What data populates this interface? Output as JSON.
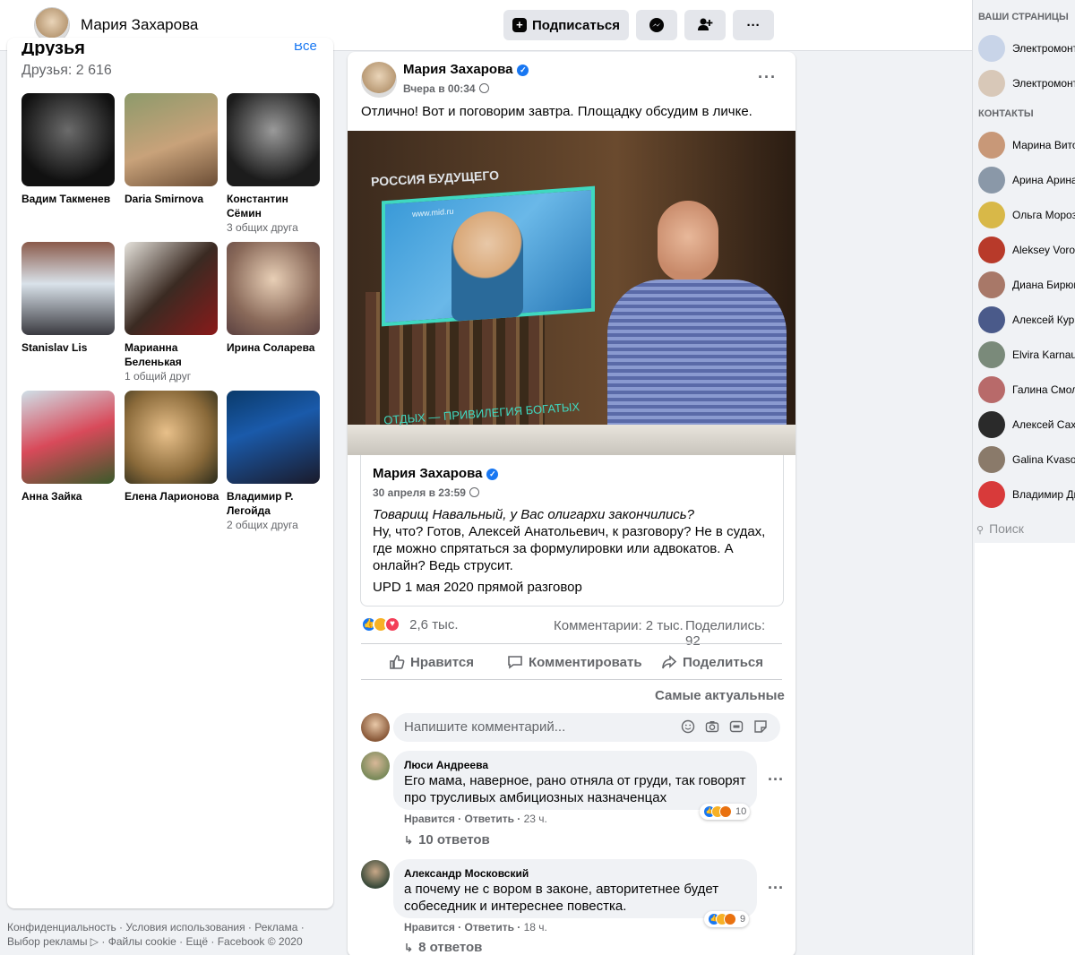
{
  "header": {
    "name": "Мария Захарова",
    "subscribe_label": "Подписаться",
    "messenger_icon": "messenger-icon",
    "add_friend_icon": "add-friend-icon",
    "more_label": "···"
  },
  "friends": {
    "title": "Друзья",
    "all_label": "Все",
    "count_label": "Друзья: 2 616",
    "items": [
      {
        "name": "Вадим Такменев",
        "mutual": ""
      },
      {
        "name": "Daria Smirnova",
        "mutual": ""
      },
      {
        "name": "Константин Сёмин",
        "mutual": "3 общих друга"
      },
      {
        "name": "Stanislav Lis",
        "mutual": ""
      },
      {
        "name": "Марианна Беленькая",
        "mutual": "1 общий друг"
      },
      {
        "name": "Ирина Соларева",
        "mutual": ""
      },
      {
        "name": "Анна Зайка",
        "mutual": ""
      },
      {
        "name": "Елена Ларионова",
        "mutual": ""
      },
      {
        "name": "Владимир Р. Легойда",
        "mutual": "2 общих друга"
      }
    ]
  },
  "footer": {
    "line1": "Конфиденциальность · Условия использования · Реклама ·",
    "line2": "Выбор рекламы ▷ · Файлы cookie · Ещё · Facebook © 2020"
  },
  "post": {
    "author": "Мария Захарова",
    "verified_mark": "✓",
    "time": "Вчера в 00:34",
    "more_label": "···",
    "text": "Отлично! Вот и поговорим завтра. Площадку обсудим в личке.",
    "video": {
      "overlay_top": "РОССИЯ БУДУЩЕГО",
      "overlay_bottom": "ОТДЫХ — ПРИВИЛЕГИЯ БОГАТЫХ",
      "site": "www.mid.ru"
    },
    "shared": {
      "author": "Мария Захарова",
      "time": "30 апреля в 23:59",
      "text_italic": "Товарищ Навальный, у Вас олигархи закончились?",
      "text": "Ну, что? Готов, Алексей Анатольевич,  к разговору? Не в судах, где можно спрятаться за формулировки или адвокатов. А онлайн? Ведь струсит.",
      "upd": "UPD 1 мая 2020 прямой разговор"
    },
    "reactions_count": "2,6 тыс.",
    "comments_count": "Комментарии: 2 тыс.",
    "shares_count": "Поделились: 92",
    "actions": {
      "like": "Нравится",
      "comment": "Комментировать",
      "share": "Поделиться"
    },
    "sort_label": "Самые актуальные",
    "comment_placeholder": "Напишите комментарий...",
    "comments": [
      {
        "author": "Люси Андреева",
        "text": "Его мама, наверное, рано отняла от груди, так говорят про трусливых амбициозных назначенцах",
        "like": "Нравится",
        "reply": "Ответить",
        "time": "23 ч.",
        "reactions": "10",
        "replies": "10 ответов"
      },
      {
        "author": "Александр Московский",
        "text": "а почему не с вором в законе, авторитетнее будет собеседник и интереснее повестка.",
        "like": "Нравится",
        "reply": "Ответить",
        "time": "18 ч.",
        "reactions": "9",
        "replies": "8 ответов"
      }
    ]
  },
  "rail": {
    "pages_title": "ВАШИ СТРАНИЦЫ",
    "pages": [
      "Электромонт",
      "Электромонт"
    ],
    "contacts_title": "КОНТАКТЫ",
    "contacts": [
      "Марина Вито",
      "Арина Арина",
      "Ольга Мороз",
      "Aleksey Voro",
      "Диана Бирюк",
      "Алексей Курь",
      "Elvira Karnau",
      "Галина Смол",
      "Алексей Сах",
      "Galina Kvaso",
      "Владимир Ди"
    ],
    "search_placeholder": "Поиск"
  },
  "colors": {
    "accent": "#1877f2",
    "background": "#f0f2f5",
    "secondary_text": "#65676b"
  }
}
